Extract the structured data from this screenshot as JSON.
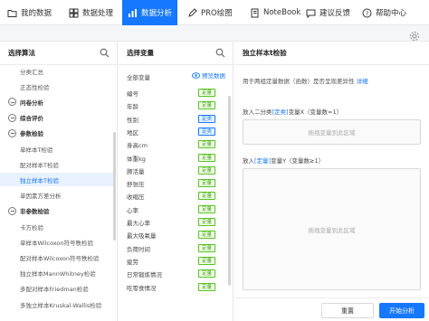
{
  "nav": {
    "items": [
      {
        "label": "我的数据",
        "icon": "folder-icon"
      },
      {
        "label": "数据处理",
        "icon": "grid-icon"
      },
      {
        "label": "数据分析",
        "icon": "chart-icon",
        "active": true
      },
      {
        "label": "PRO绘图",
        "icon": "draw-icon"
      },
      {
        "label": "NoteBook",
        "icon": "notebook-icon"
      },
      {
        "label": "建议反馈",
        "icon": "feedback-icon"
      },
      {
        "label": "帮助中心",
        "icon": "help-icon"
      }
    ]
  },
  "algo": {
    "title": "选择算法",
    "rows": [
      {
        "label": "分类汇总",
        "type": "item"
      },
      {
        "label": "正态性检验",
        "type": "item"
      },
      {
        "label": "问卷分析",
        "type": "cat"
      },
      {
        "label": "综合评价",
        "type": "cat"
      },
      {
        "label": "参数检验",
        "type": "cat"
      },
      {
        "label": "单样本T检验",
        "type": "item"
      },
      {
        "label": "配对样本T检验",
        "type": "item"
      },
      {
        "label": "独立样本T检验",
        "type": "item",
        "selected": true
      },
      {
        "label": "单因素方差分析",
        "type": "item"
      },
      {
        "label": "非参数检验",
        "type": "cat"
      },
      {
        "label": "卡方检验",
        "type": "item"
      },
      {
        "label": "单样本Wilcoxon符号秩检验",
        "type": "item"
      },
      {
        "label": "配对样本Wilcoxon符号秩检验",
        "type": "item"
      },
      {
        "label": "独立样本MannWhitney检验",
        "type": "item"
      },
      {
        "label": "多配对样本Friedman检验",
        "type": "item"
      },
      {
        "label": "多独立样本Kruskal-Wallis检验",
        "type": "item"
      }
    ]
  },
  "vars": {
    "title": "选择变量",
    "all_label": "全部变量",
    "preview_label": "预览数据",
    "list": [
      {
        "name": "编号",
        "tag": "定量",
        "color": "green"
      },
      {
        "name": "年龄",
        "tag": "定量",
        "color": "green"
      },
      {
        "name": "性别",
        "tag": "定类",
        "color": "blue"
      },
      {
        "name": "地区",
        "tag": "定类",
        "color": "blue"
      },
      {
        "name": "身高cm",
        "tag": "定量",
        "color": "green"
      },
      {
        "name": "体重kg",
        "tag": "定量",
        "color": "green"
      },
      {
        "name": "肺活量",
        "tag": "定量",
        "color": "green"
      },
      {
        "name": "舒张压",
        "tag": "定量",
        "color": "green"
      },
      {
        "name": "收缩压",
        "tag": "定量",
        "color": "green"
      },
      {
        "name": "心率",
        "tag": "定量",
        "color": "green"
      },
      {
        "name": "最大心率",
        "tag": "定量",
        "color": "green"
      },
      {
        "name": "最大吸氧量",
        "tag": "定量",
        "color": "green"
      },
      {
        "name": "负荷时间",
        "tag": "定量",
        "color": "green"
      },
      {
        "name": "疲劳",
        "tag": "定量",
        "color": "green"
      },
      {
        "name": "日常锻炼情况",
        "tag": "定量",
        "color": "green"
      },
      {
        "name": "吃零食情况",
        "tag": "定量",
        "color": "green"
      }
    ]
  },
  "panel": {
    "title": "独立样本t检验",
    "desc": "用于两组定量数据（函数）是否呈现差异性",
    "desc_link": "详细",
    "x_prefix": "放入二分类",
    "x_type": "[定类]",
    "x_suffix": "变量X（变量数=1）",
    "x_drop": "拖拽变量到此区域",
    "y_prefix": "放入",
    "y_type": "[定量]",
    "y_suffix": "变量Y（变量数≥1）",
    "y_drop": "拖拽变量到此区域",
    "reset": "重置",
    "start": "开始分析"
  },
  "colors": {
    "accent": "#1677ff",
    "quant_tag": "#52c41a",
    "cat_tag": "#1677ff"
  }
}
